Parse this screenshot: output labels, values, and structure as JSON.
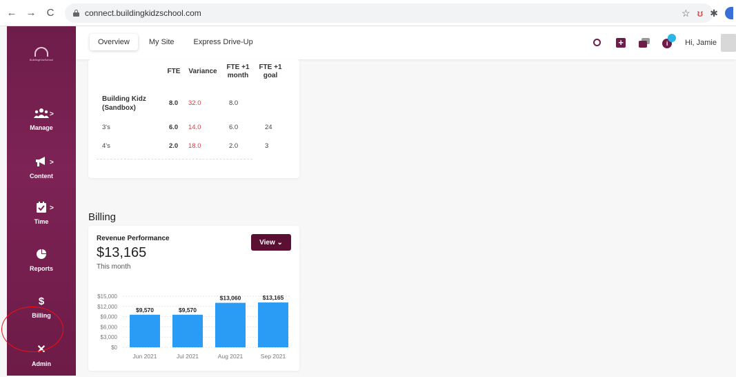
{
  "browser": {
    "url": "connect.buildingkidzschool.com",
    "back": "←",
    "forward": "→",
    "reload": "C"
  },
  "logo_text": "BuildingKidzSchool",
  "sidebar": {
    "items": [
      {
        "label": "Manage",
        "icon": "users-icon",
        "chevron": ">"
      },
      {
        "label": "Content",
        "icon": "megaphone-icon",
        "chevron": ">"
      },
      {
        "label": "Time",
        "icon": "calendar-icon",
        "chevron": ">"
      },
      {
        "label": "Reports",
        "icon": "pie-chart-icon"
      },
      {
        "label": "Billing",
        "icon": "dollar-icon",
        "glyph": "$"
      },
      {
        "label": "Admin",
        "icon": "tools-icon",
        "glyph": "✕"
      }
    ]
  },
  "header": {
    "tabs": [
      "Overview",
      "My Site",
      "Express Drive-Up"
    ],
    "active_tab": "Overview",
    "greeting": "Hi, Jamie",
    "plus_glyph": "+",
    "info_glyph": "i"
  },
  "fte_table": {
    "headers": [
      "FTE",
      "Variance",
      "FTE +1 month",
      "FTE +1 goal"
    ],
    "header_lines": [
      [
        "FTE"
      ],
      [
        "Variance"
      ],
      [
        "FTE +1",
        "month"
      ],
      [
        "FTE +1",
        "goal"
      ]
    ],
    "rows": [
      {
        "name": "Building Kidz (Sandbox)",
        "name_lines": [
          "Building Kidz",
          "(Sandbox)"
        ],
        "fte": "8.0",
        "variance": "32.0",
        "fte_month": "8.0",
        "goal": ""
      },
      {
        "name": "3's",
        "fte": "6.0",
        "variance": "14.0",
        "fte_month": "6.0",
        "goal": "24"
      },
      {
        "name": "4's",
        "fte": "2.0",
        "variance": "18.0",
        "fte_month": "2.0",
        "goal": "3"
      }
    ]
  },
  "billing": {
    "section_title": "Billing",
    "card_title": "Revenue Performance",
    "amount": "$13,165",
    "subtitle": "This month",
    "view_label": "View ⌄"
  },
  "chart_data": {
    "type": "bar",
    "categories": [
      "Jun 2021",
      "Jul 2021",
      "Aug 2021",
      "Sep 2021"
    ],
    "values": [
      9570,
      9570,
      13060,
      13165
    ],
    "data_labels": [
      "$9,570",
      "$9,570",
      "$13,060",
      "$13,165"
    ],
    "y_ticks": [
      0,
      3000,
      6000,
      9000,
      12000,
      15000
    ],
    "y_tick_labels": [
      "$0",
      "$3,000",
      "$6,000",
      "$9,000",
      "$12,000",
      "$15,000"
    ],
    "ylim": [
      0,
      15000
    ],
    "bar_color": "#2b9cf5",
    "grid": true
  },
  "colors": {
    "sidebar": "#6e1d4a",
    "accent": "#5a0f33",
    "variance_red": "#e0393e",
    "bar_blue": "#2b9cf5"
  }
}
